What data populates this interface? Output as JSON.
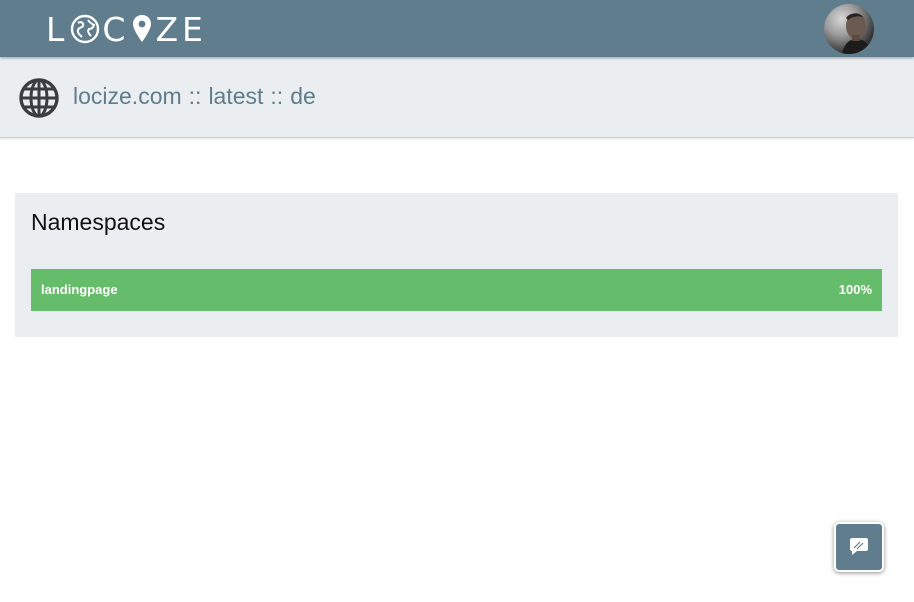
{
  "header": {
    "logo": {
      "left": "L",
      "middle": "C",
      "right": "ZE"
    },
    "avatar_icon": "user-avatar"
  },
  "breadcrumb": {
    "icon": "globe-icon",
    "project": "locize.com",
    "separator": "::",
    "version": "latest",
    "language": "de"
  },
  "namespaces": {
    "title": "Namespaces",
    "items": [
      {
        "name": "landingpage",
        "percent_label": "100%",
        "progress": 1.0
      }
    ]
  },
  "chat": {
    "icon": "chat-bubbles-icon"
  },
  "colors": {
    "header_bg": "#5f7d8c",
    "subheader_bg": "#ebeef1",
    "progress_green": "#65bc6a",
    "link": "#5f7d8c"
  }
}
